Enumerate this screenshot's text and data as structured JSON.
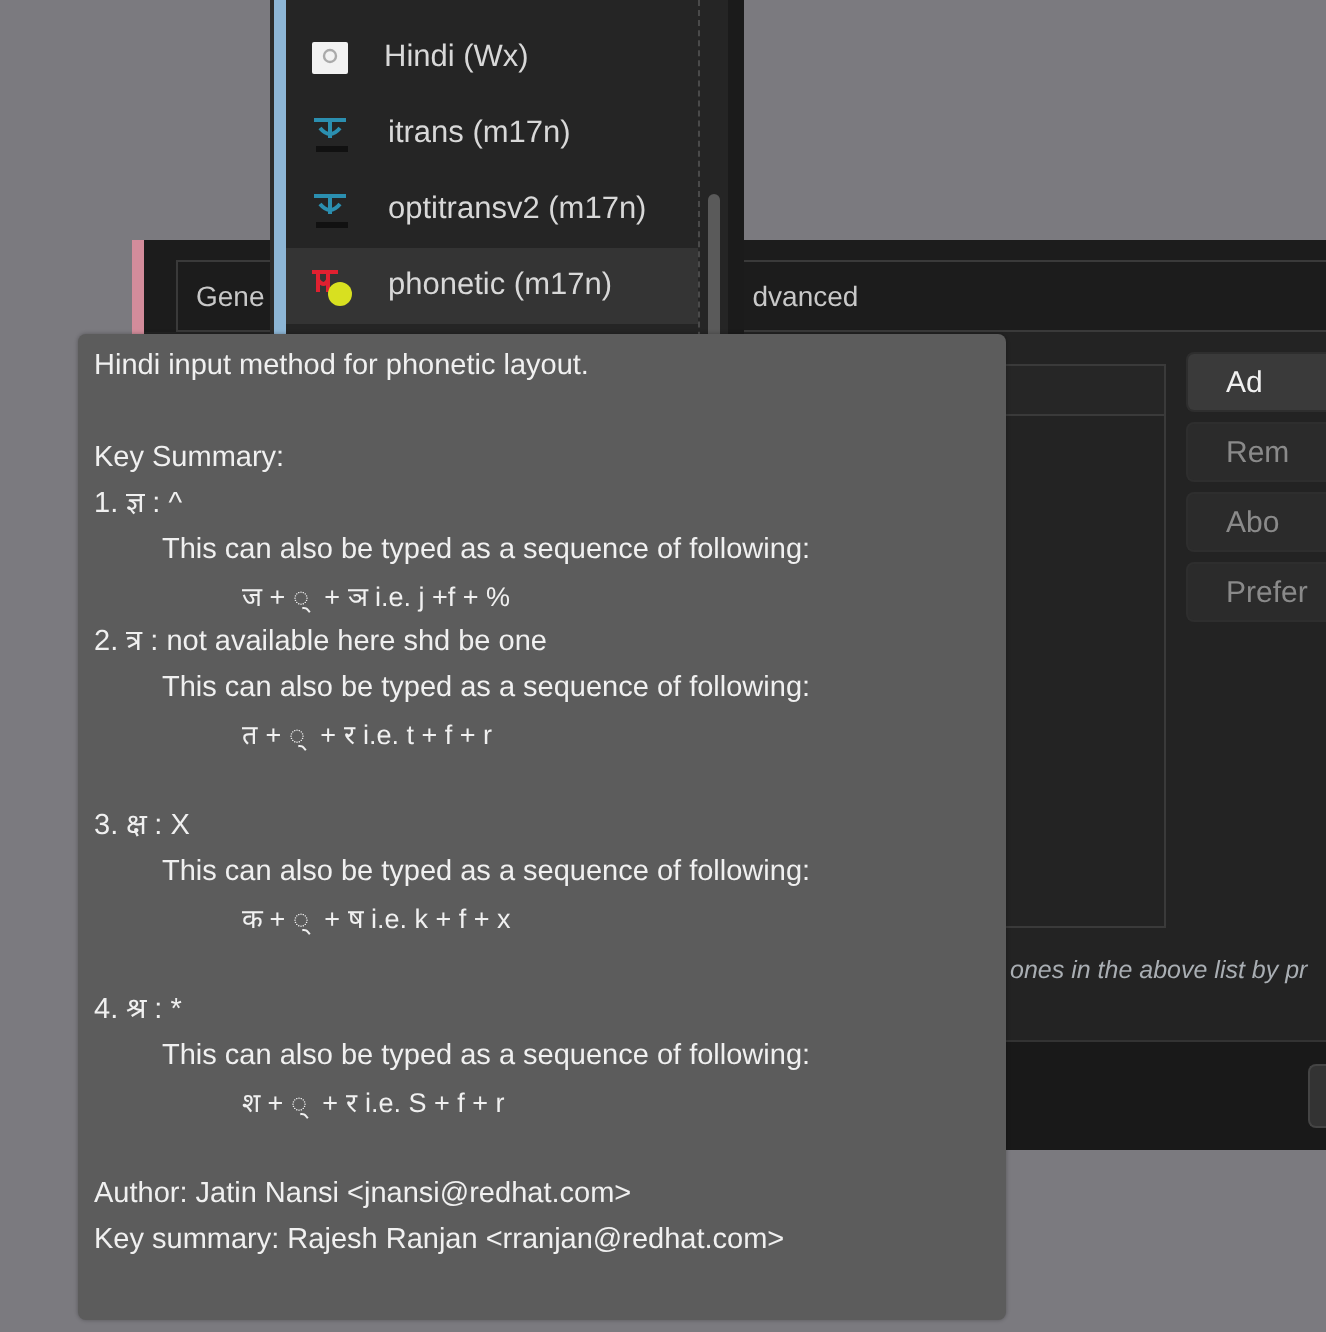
{
  "input_method_list": {
    "items": [
      {
        "label": "Hindi (Wx)",
        "kind": "at",
        "selected": false
      },
      {
        "label": "itrans (m17n)",
        "kind": "ka",
        "selected": false
      },
      {
        "label": "optitransv2 (m17n)",
        "kind": "ka",
        "selected": false
      },
      {
        "label": "phonetic (m17n)",
        "kind": "hi",
        "selected": true
      }
    ]
  },
  "dialog": {
    "tabs": [
      {
        "label": "Gene"
      },
      {
        "label": "dvanced"
      }
    ],
    "buttons": [
      {
        "label": "Ad",
        "disabled": false
      },
      {
        "label": "Rem",
        "disabled": true
      },
      {
        "label": "Abo",
        "disabled": true
      },
      {
        "label": "Prefer",
        "disabled": true
      }
    ],
    "hint": "ones in the above list by pr"
  },
  "tooltip": {
    "blocks": [
      {
        "lines": [
          {
            "text": "Hindi input method for phonetic layout.",
            "kind": "plain"
          }
        ]
      },
      {
        "lines": [
          {
            "text": "Key Summary:",
            "kind": "plain"
          },
          {
            "text": "1. ज्ञ : ^",
            "kind": "plain"
          },
          {
            "text": "This can also be typed as a sequence of following:",
            "kind": "note"
          },
          {
            "text": "ज + ्  + ञ i.e. j +f + %",
            "kind": "sequence"
          },
          {
            "text": "2. त्र : not available here shd be one",
            "kind": "plain"
          },
          {
            "text": "This can also be typed as a sequence of following:",
            "kind": "note"
          },
          {
            "text": "त + ्  + र i.e. t + f + r",
            "kind": "sequence"
          }
        ]
      },
      {
        "lines": [
          {
            "text": "3. क्ष : X",
            "kind": "plain"
          },
          {
            "text": "This can also be typed as a sequence of following:",
            "kind": "note"
          },
          {
            "text": "क + ्  + ष i.e. k + f + x",
            "kind": "sequence"
          }
        ]
      },
      {
        "lines": [
          {
            "text": "4. श्र : *",
            "kind": "plain"
          },
          {
            "text": "This can also be typed as a sequence of following:",
            "kind": "note"
          },
          {
            "text": "श + ्  + र i.e. S + f + r",
            "kind": "sequence"
          }
        ]
      },
      {
        "lines": [
          {
            "text": "Author: Jatin Nansi <jnansi@redhat.com>",
            "kind": "plain"
          },
          {
            "text": "Key summary: Rajesh Ranjan <rranjan@redhat.com>",
            "kind": "plain"
          }
        ]
      }
    ]
  }
}
